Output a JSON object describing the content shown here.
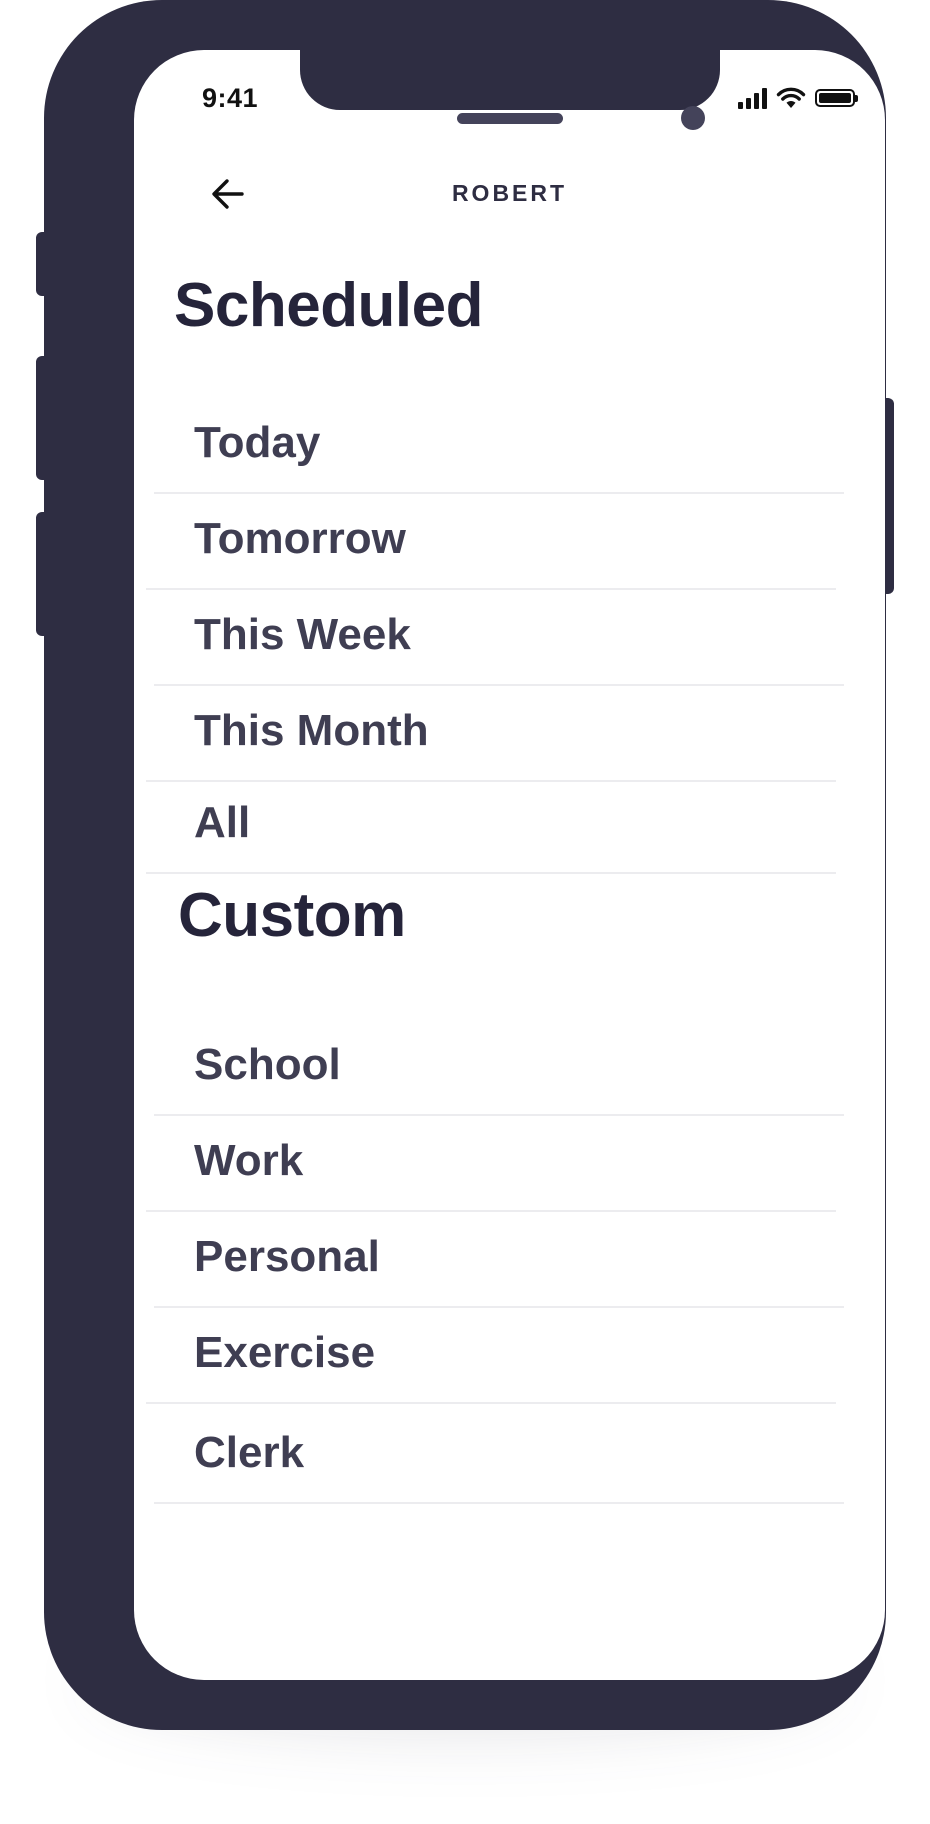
{
  "status_bar": {
    "time": "9:41"
  },
  "nav": {
    "title": "ROBERT",
    "back_icon": "arrow-left-icon"
  },
  "sections": {
    "scheduled": {
      "title": "Scheduled",
      "items": [
        "Today",
        "Tomorrow",
        "This Week",
        "This Month",
        "All"
      ]
    },
    "custom": {
      "title": "Custom",
      "items": [
        "School",
        "Work",
        "Personal",
        "Exercise",
        "Clerk"
      ]
    }
  },
  "colors": {
    "frame": "#2e2d42",
    "heading": "#25243a",
    "item_text": "#3f3e52",
    "divider": "#ececef"
  }
}
